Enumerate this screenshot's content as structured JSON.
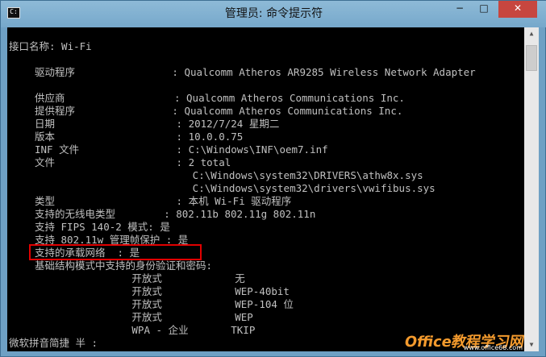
{
  "window": {
    "title": "管理员: 命令提示符",
    "controls": [
      "−",
      "□",
      "✕"
    ]
  },
  "console": {
    "lines": [
      {
        "text": "接口名称: Wi-Fi",
        "indent": 0
      },
      {
        "text": "",
        "indent": 0
      },
      {
        "text": "驱动程序                : Qualcomm Atheros AR9285 Wireless Network Adapter",
        "indent": 1
      },
      {
        "text": "",
        "indent": 0
      },
      {
        "text": "供应商                  : Qualcomm Atheros Communications Inc.",
        "indent": 1
      },
      {
        "text": "提供程序                : Qualcomm Atheros Communications Inc.",
        "indent": 1
      },
      {
        "text": "日期                    : 2012/7/24 星期二",
        "indent": 1
      },
      {
        "text": "版本                    : 10.0.0.75",
        "indent": 1
      },
      {
        "text": "INF 文件                : C:\\Windows\\INF\\oem7.inf",
        "indent": 1
      },
      {
        "text": "文件                    : 2 total",
        "indent": 1
      },
      {
        "text": "                          C:\\Windows\\system32\\DRIVERS\\athw8x.sys",
        "indent": 1
      },
      {
        "text": "                          C:\\Windows\\system32\\drivers\\vwifibus.sys",
        "indent": 1
      },
      {
        "text": "类型                    : 本机 Wi-Fi 驱动程序",
        "indent": 1
      },
      {
        "text": "支持的无线电类型        : 802.11b 802.11g 802.11n",
        "indent": 1
      },
      {
        "text": "支持 FIPS 140-2 模式: 是",
        "indent": 1
      },
      {
        "text": "支持 802.11w 管理帧保护 : 是",
        "indent": 1
      },
      {
        "text": "支持的承载网络  : 是",
        "indent": 1
      },
      {
        "text": "基础结构模式中支持的身份验证和密码:",
        "indent": 1
      },
      {
        "text": "                开放式            无",
        "indent": 1
      },
      {
        "text": "                开放式            WEP-40bit",
        "indent": 1
      },
      {
        "text": "                开放式            WEP-104 位",
        "indent": 1
      },
      {
        "text": "                开放式            WEP",
        "indent": 1
      },
      {
        "text": "                WPA - 企业       TKIP",
        "indent": 1
      },
      {
        "text": "微软拼音简捷 半 :",
        "indent": 0
      }
    ]
  },
  "watermark": {
    "text": "Office教程学习网",
    "url": "www.office68.com"
  }
}
